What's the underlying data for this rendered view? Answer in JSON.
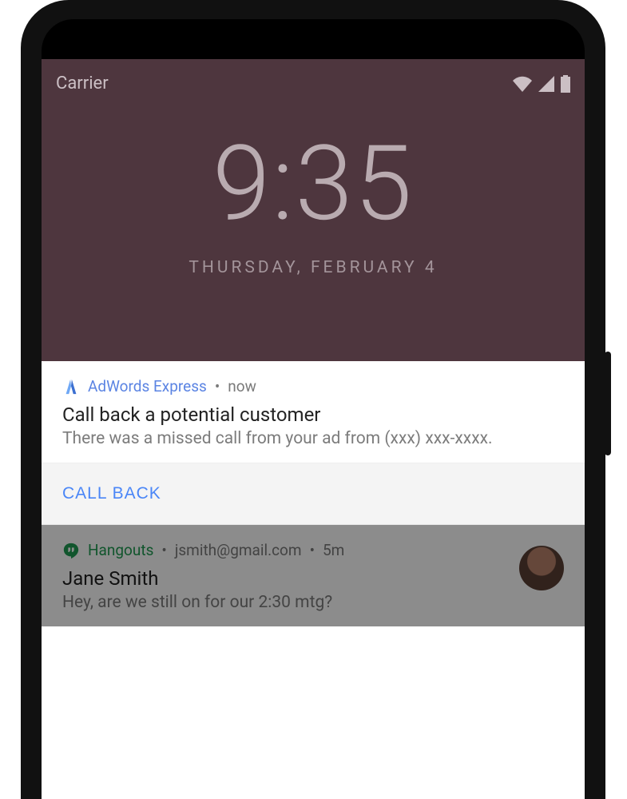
{
  "status": {
    "carrier": "Carrier"
  },
  "lock": {
    "time": "9:35",
    "date": "THURSDAY, FEBRUARY 4"
  },
  "primary_notification": {
    "app_name": "AdWords Express",
    "time_sep": " • ",
    "time": "now",
    "title": "Call back a potential customer",
    "body": "There was a missed call from your ad from (xxx) xxx-xxxx.",
    "action_label": "CALL BACK"
  },
  "secondary_notification": {
    "app_name": "Hangouts",
    "sub_sep": " • ",
    "account": "jsmith@gmail.com",
    "time": "5m",
    "title": "Jane Smith",
    "body": "Hey, are we still on for our 2:30 mtg?"
  }
}
